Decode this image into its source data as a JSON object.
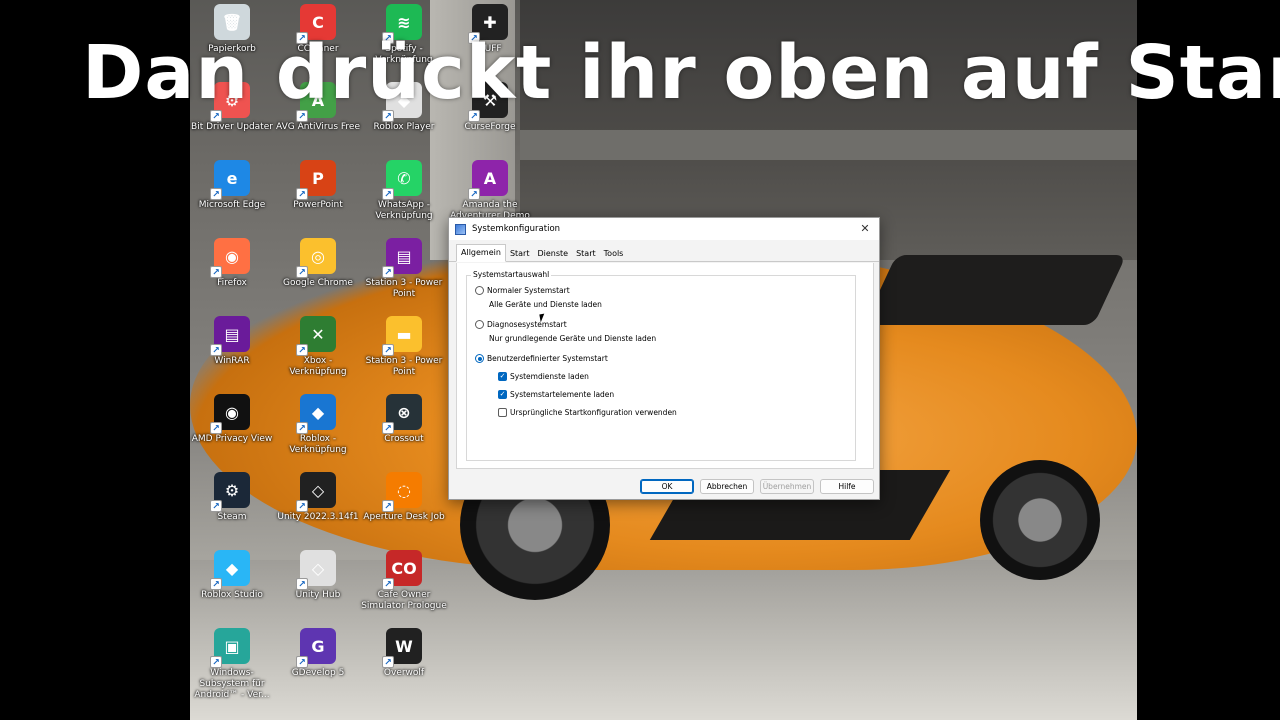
{
  "caption": "Dan drückt ihr oben auf Start",
  "desktop_icons": [
    {
      "label": "Papierkorb",
      "icon": "recycle-bin-icon",
      "color": "#cfd8dc",
      "glyph": "🗑"
    },
    {
      "label": "CCleaner",
      "icon": "ccleaner-icon",
      "color": "#e53935",
      "glyph": "C"
    },
    {
      "label": "Spotify - Verknüpfung",
      "icon": "spotify-icon",
      "color": "#1db954",
      "glyph": "≋"
    },
    {
      "label": "BUFF",
      "icon": "buff-icon",
      "color": "#222222",
      "glyph": "✚"
    },
    {
      "label": "Bit Driver Updater",
      "icon": "bit-driver-icon",
      "color": "#ef5350",
      "glyph": "⚙"
    },
    {
      "label": "AVG AntiVirus Free",
      "icon": "avg-icon",
      "color": "#43a047",
      "glyph": "A"
    },
    {
      "label": "Roblox Player",
      "icon": "roblox-player-icon",
      "color": "#e0e0e0",
      "glyph": "◆"
    },
    {
      "label": "CurseForge",
      "icon": "curseforge-icon",
      "color": "#212121",
      "glyph": "⚒"
    },
    {
      "label": "Microsoft Edge",
      "icon": "edge-icon",
      "color": "#1e88e5",
      "glyph": "e"
    },
    {
      "label": "PowerPoint",
      "icon": "powerpoint-icon",
      "color": "#d84315",
      "glyph": "P"
    },
    {
      "label": "WhatsApp - Verknüpfung",
      "icon": "whatsapp-icon",
      "color": "#25d366",
      "glyph": "✆"
    },
    {
      "label": "Amanda the Adventurer Demo",
      "icon": "amanda-icon",
      "color": "#8e24aa",
      "glyph": "A"
    },
    {
      "label": "Firefox",
      "icon": "firefox-icon",
      "color": "#ff7043",
      "glyph": "◉"
    },
    {
      "label": "Google Chrome",
      "icon": "chrome-icon",
      "color": "#fbc02d",
      "glyph": "◎"
    },
    {
      "label": "Station 3 - Power Point",
      "icon": "winrar-archive-icon",
      "color": "#7b1fa2",
      "glyph": "▤"
    },
    {
      "label": "WinRAR",
      "icon": "winrar-icon",
      "color": "#6a1b9a",
      "glyph": "▤"
    },
    {
      "label": "Xbox - Verknüpfung",
      "icon": "xbox-icon",
      "color": "#2e7d32",
      "glyph": "✕"
    },
    {
      "label": "Station 3 - Power Point",
      "icon": "folder-icon",
      "color": "#fbc02d",
      "glyph": "▬"
    },
    {
      "label": "AMD Privacy View",
      "icon": "amd-privacy-icon",
      "color": "#111111",
      "glyph": "◉"
    },
    {
      "label": "Roblox - Verknüpfung",
      "icon": "roblox-icon",
      "color": "#1976d2",
      "glyph": "◆"
    },
    {
      "label": "Crossout",
      "icon": "crossout-icon",
      "color": "#263238",
      "glyph": "⊗"
    },
    {
      "label": "Steam",
      "icon": "steam-icon",
      "color": "#1b2838",
      "glyph": "⚙"
    },
    {
      "label": "Unity 2022.3.14f1",
      "icon": "unity-icon",
      "color": "#212121",
      "glyph": "◇"
    },
    {
      "label": "Aperture Desk Job",
      "icon": "aperture-icon",
      "color": "#f57c00",
      "glyph": "◌"
    },
    {
      "label": "Roblox Studio",
      "icon": "roblox-studio-icon",
      "color": "#29b6f6",
      "glyph": "◆"
    },
    {
      "label": "Unity Hub",
      "icon": "unity-hub-icon",
      "color": "#e0e0e0",
      "glyph": "◇"
    },
    {
      "label": "Cafe Owner Simulator Prologue",
      "icon": "cafe-owner-icon",
      "color": "#c62828",
      "glyph": "CO"
    },
    {
      "label": "Windows-Subsystem für Android™ - Ver...",
      "icon": "android-subsystem-icon",
      "color": "#26a69a",
      "glyph": "▣"
    },
    {
      "label": "GDevelop 5",
      "icon": "gdevelop-icon",
      "color": "#5e35b1",
      "glyph": "G"
    },
    {
      "label": "Overwolf",
      "icon": "overwolf-icon",
      "color": "#212121",
      "glyph": "W"
    }
  ],
  "dialog": {
    "title": "Systemkonfiguration",
    "close": "✕",
    "tabs": [
      {
        "label": "Allgemein",
        "active": true
      },
      {
        "label": "Start",
        "active": false
      },
      {
        "label": "Dienste",
        "active": false
      },
      {
        "label": "Start",
        "active": false
      },
      {
        "label": "Tools",
        "active": false
      }
    ],
    "group_title": "Systemstartauswahl",
    "radio_normal": "Normaler Systemstart",
    "radio_normal_desc": "Alle Geräte und Dienste laden",
    "radio_diag": "Diagnosesystemstart",
    "radio_diag_desc": "Nur grundlegende Geräte und Dienste laden",
    "radio_custom": "Benutzerdefinierter Systemstart",
    "check_services": "Systemdienste laden",
    "check_startup": "Systemstartelemente laden",
    "check_original": "Ursprüngliche Startkonfiguration verwenden",
    "btn_ok": "OK",
    "btn_cancel": "Abbrechen",
    "btn_apply": "Übernehmen",
    "btn_help": "Hilfe",
    "check_mark": "✓",
    "accent": "#0067c0"
  }
}
